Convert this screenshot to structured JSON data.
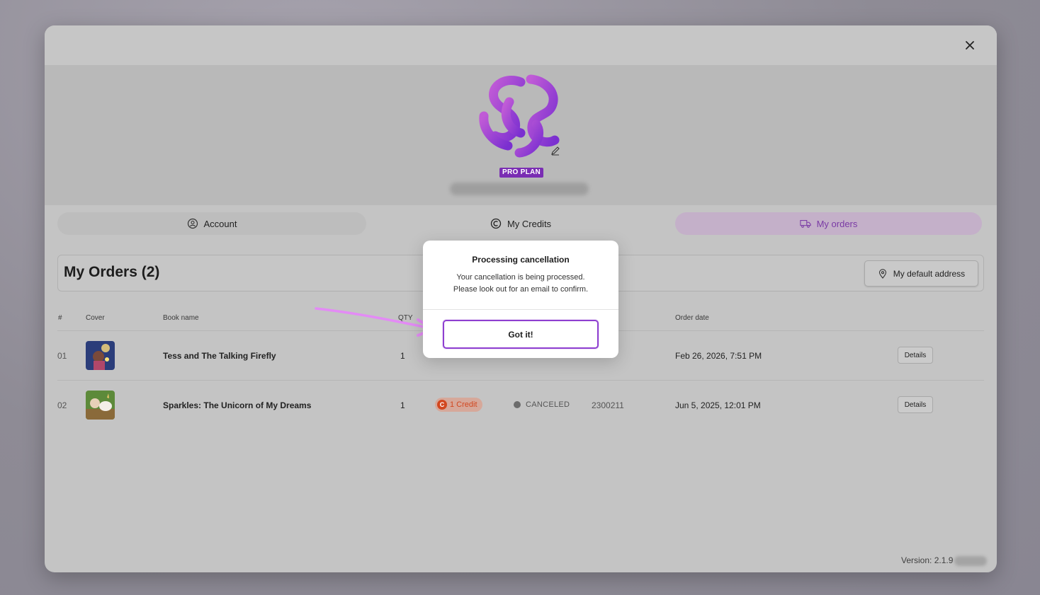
{
  "modal": {
    "plan_badge": "PRO PLAN",
    "tabs": [
      {
        "label": "Account",
        "icon": "account-icon"
      },
      {
        "label": "My Credits",
        "icon": "credits-icon"
      },
      {
        "label": "My orders",
        "icon": "truck-icon"
      }
    ],
    "orders_title": "My Orders (2)",
    "address_button": "My default address",
    "version": "Version: 2.1.9"
  },
  "table": {
    "headers": [
      "#",
      "Cover",
      "Book name",
      "QTY",
      "Order date"
    ],
    "rows": [
      {
        "num": "01",
        "book_name": "Tess and The Talking Firefly",
        "qty": "1",
        "order_date": "Feb 26, 2026, 7:51 PM",
        "details": "Details"
      },
      {
        "num": "02",
        "book_name": "Sparkles: The Unicorn of My Dreams",
        "qty": "1",
        "credit": "1 Credit",
        "status": "CANCELED",
        "order_id": "2300211",
        "order_date": "Jun 5, 2025, 12:01 PM",
        "details": "Details"
      }
    ]
  },
  "dialog": {
    "title": "Processing cancellation",
    "message_line1": "Your cancellation is being processed.",
    "message_line2": "Please look out for an email to confirm.",
    "button": "Got it!"
  },
  "colors": {
    "accent": "#8e3fd0",
    "badge": "#7a2db3",
    "credit": "#d2471f",
    "arrow": "#e38bf5"
  }
}
